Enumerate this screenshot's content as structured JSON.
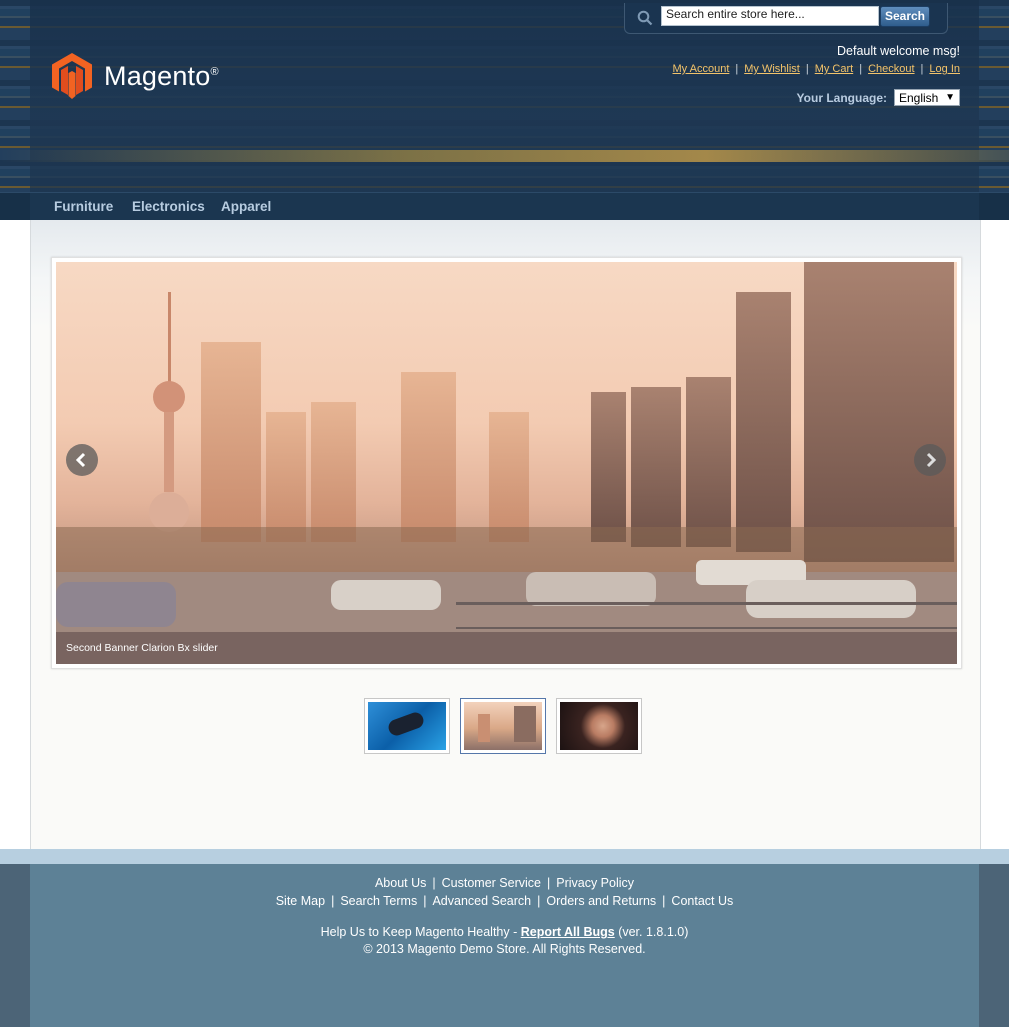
{
  "brand": {
    "name": "Magento",
    "mark": "®"
  },
  "search": {
    "placeholder": "Search entire store here...",
    "value": "Search entire store here...",
    "button": "Search"
  },
  "header": {
    "welcome": "Default welcome msg!",
    "links": [
      "My Account",
      "My Wishlist",
      "My Cart",
      "Checkout",
      "Log In"
    ],
    "language_label": "Your Language:",
    "language_value": "English"
  },
  "nav": {
    "items": [
      "Furniture",
      "Electronics",
      "Apparel"
    ]
  },
  "slider": {
    "caption": "Second Banner Clarion Bx slider",
    "thumbs": [
      "underwater",
      "city-skyline",
      "portrait"
    ],
    "active_index": 1
  },
  "footer": {
    "row1": [
      "About Us",
      "Customer Service",
      "Privacy Policy"
    ],
    "row2": [
      "Site Map",
      "Search Terms",
      "Advanced Search",
      "Orders and Returns",
      "Contact Us"
    ],
    "help_prefix": "Help Us to Keep Magento Healthy - ",
    "help_link": "Report All Bugs",
    "version": " (ver. 1.8.1.0)",
    "copyright": "© 2013 Magento Demo Store. All Rights Reserved."
  },
  "colors": {
    "link_gold": "#f2c36b",
    "nav_text": "#b7cce0",
    "footer_bg": "#5d8196",
    "header_bg": "#1c3550"
  }
}
